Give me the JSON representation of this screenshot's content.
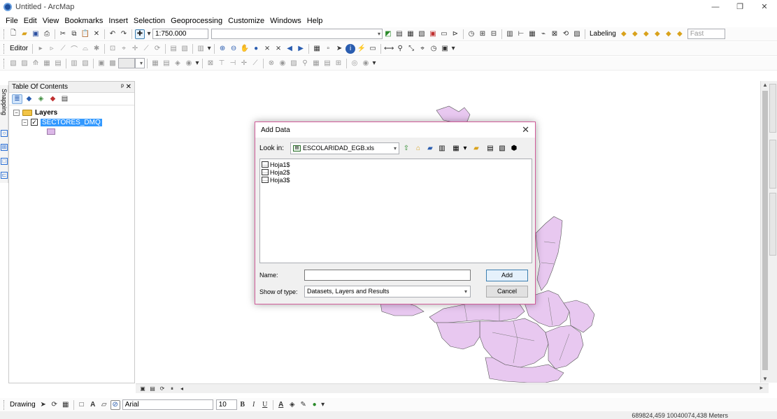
{
  "window": {
    "title": "Untitled - ArcMap",
    "controls": [
      "—",
      "❐",
      "✕"
    ]
  },
  "menu": [
    "File",
    "Edit",
    "View",
    "Bookmarks",
    "Insert",
    "Selection",
    "Geoprocessing",
    "Customize",
    "Windows",
    "Help"
  ],
  "standard_toolbar": {
    "scale": "1:750.000",
    "labeling": "Labeling",
    "fast": "Fast"
  },
  "editor_toolbar": {
    "editor": "Editor"
  },
  "toc": {
    "title": "Table Of Contents",
    "pin": "ᵖ ✕",
    "root": "Layers",
    "layer": "SECTORES_DMQ"
  },
  "snapping_label": "Snapping",
  "dialog": {
    "title": "Add Data",
    "look_in_label": "Look in:",
    "look_in_value": "ESCOLARIDAD_EGB.xls",
    "files": [
      "Hoja1$",
      "Hoja2$",
      "Hoja3$"
    ],
    "name_label": "Name:",
    "name_value": "",
    "type_label": "Show of type:",
    "type_value": "Datasets, Layers and Results",
    "add_button": "Add",
    "cancel_button": "Cancel"
  },
  "drawing_toolbar": {
    "drawing": "Drawing",
    "font": "Arial",
    "size": "10",
    "bold": "B",
    "italic": "I",
    "underline": "U"
  },
  "status": {
    "coords": "689824,459  10040074,438 Meters"
  },
  "colors": {
    "polygon_fill": "#e8c8f0",
    "polygon_stroke": "#555555",
    "selection": "#3399ff",
    "dialog_border": "#d25c9a"
  }
}
